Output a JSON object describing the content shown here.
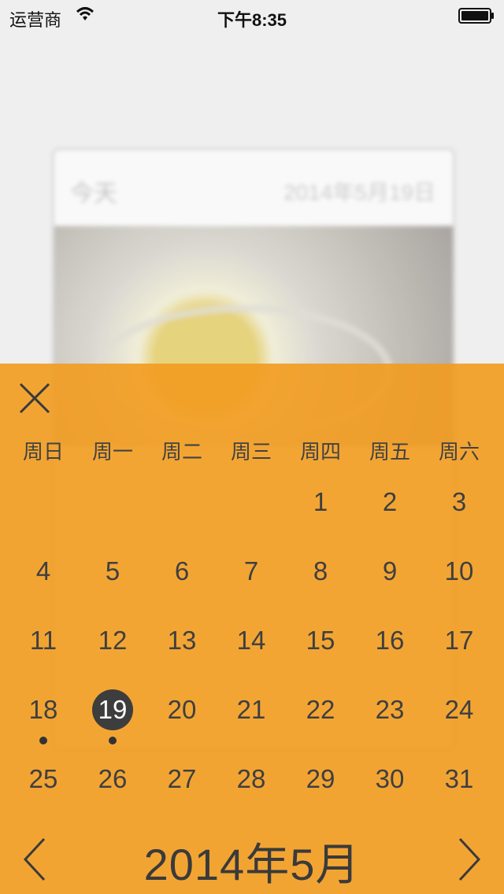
{
  "status_bar": {
    "carrier": "运营商",
    "time": "下午8:35"
  },
  "background_card": {
    "today_label": "今天",
    "date": "2014年5月19日"
  },
  "calendar": {
    "weekdays": [
      "周日",
      "周一",
      "周二",
      "周三",
      "周四",
      "周五",
      "周六"
    ],
    "leading_blanks": 4,
    "days": [
      {
        "n": "1"
      },
      {
        "n": "2"
      },
      {
        "n": "3"
      },
      {
        "n": "4"
      },
      {
        "n": "5"
      },
      {
        "n": "6"
      },
      {
        "n": "7"
      },
      {
        "n": "8"
      },
      {
        "n": "9"
      },
      {
        "n": "10"
      },
      {
        "n": "11"
      },
      {
        "n": "12"
      },
      {
        "n": "13"
      },
      {
        "n": "14"
      },
      {
        "n": "15"
      },
      {
        "n": "16"
      },
      {
        "n": "17"
      },
      {
        "n": "18",
        "dot": true
      },
      {
        "n": "19",
        "selected": true,
        "dot": true
      },
      {
        "n": "20"
      },
      {
        "n": "21"
      },
      {
        "n": "22"
      },
      {
        "n": "23"
      },
      {
        "n": "24"
      },
      {
        "n": "25"
      },
      {
        "n": "26"
      },
      {
        "n": "27"
      },
      {
        "n": "28"
      },
      {
        "n": "29"
      },
      {
        "n": "30"
      },
      {
        "n": "31"
      }
    ],
    "month_label": "2014年5月",
    "accent_color": "#f29b1e",
    "selected_color": "#3d3d3d"
  },
  "icons": {
    "close": "close-icon",
    "prev": "chevron-left-icon",
    "next": "chevron-right-icon",
    "wifi": "wifi-icon",
    "battery": "battery-icon"
  }
}
